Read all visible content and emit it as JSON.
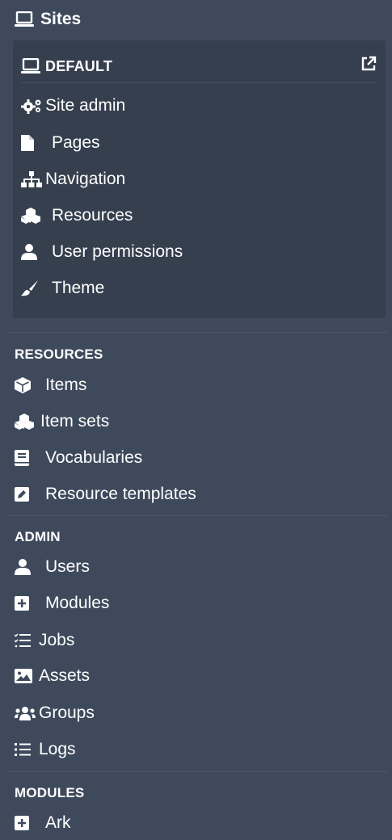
{
  "sites": {
    "title": "Sites"
  },
  "site": {
    "name": "DEFAULT",
    "items": [
      {
        "label": "Site admin",
        "icon": "gears-icon"
      },
      {
        "label": "Pages",
        "icon": "file-icon"
      },
      {
        "label": "Navigation",
        "icon": "sitemap-icon"
      },
      {
        "label": "Resources",
        "icon": "cubes-icon"
      },
      {
        "label": "User permissions",
        "icon": "user-icon"
      },
      {
        "label": "Theme",
        "icon": "brush-icon"
      }
    ]
  },
  "resources": {
    "heading": "RESOURCES",
    "items": [
      {
        "label": "Items",
        "icon": "cube-icon"
      },
      {
        "label": "Item sets",
        "icon": "cubes-icon"
      },
      {
        "label": "Vocabularies",
        "icon": "book-icon"
      },
      {
        "label": "Resource templates",
        "icon": "edit-icon"
      }
    ]
  },
  "admin": {
    "heading": "ADMIN",
    "items": [
      {
        "label": "Users",
        "icon": "user-icon"
      },
      {
        "label": "Modules",
        "icon": "plus-square-icon"
      },
      {
        "label": "Jobs",
        "icon": "tasks-icon"
      },
      {
        "label": "Assets",
        "icon": "image-icon"
      },
      {
        "label": "Groups",
        "icon": "users-icon"
      },
      {
        "label": "Logs",
        "icon": "list-icon"
      }
    ]
  },
  "modules": {
    "heading": "MODULES",
    "items": [
      {
        "label": "Ark",
        "icon": "plus-square-icon"
      }
    ]
  }
}
